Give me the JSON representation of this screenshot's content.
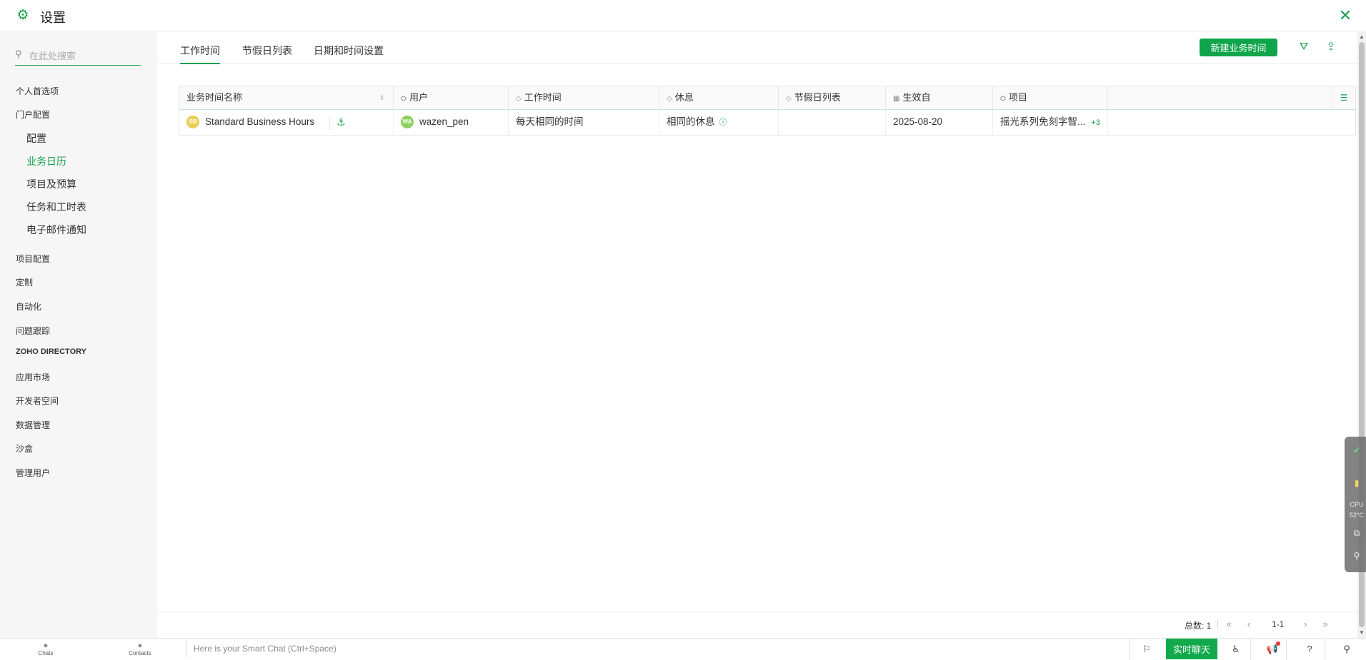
{
  "header": {
    "title": "设置"
  },
  "sidebar": {
    "search_placeholder": "在此处搜索",
    "items": [
      {
        "label": "个人首选项"
      },
      {
        "label": "门户配置"
      },
      {
        "label": "配置"
      },
      {
        "label": "业务日历"
      },
      {
        "label": "项目及预算"
      },
      {
        "label": "任务和工时表"
      },
      {
        "label": "电子邮件通知"
      },
      {
        "label": "项目配置"
      },
      {
        "label": "定制"
      },
      {
        "label": "自动化"
      },
      {
        "label": "问题跟踪"
      },
      {
        "label": "ZOHO DIRECTORY"
      },
      {
        "label": "应用市场"
      },
      {
        "label": "开发者空间"
      },
      {
        "label": "数据管理"
      },
      {
        "label": "沙盒"
      },
      {
        "label": "管理用户"
      }
    ]
  },
  "tabs": [
    {
      "label": "工作时间"
    },
    {
      "label": "节假日列表"
    },
    {
      "label": "日期和时间设置"
    }
  ],
  "toolbar": {
    "new_button": "新建业务时间"
  },
  "table": {
    "columns": [
      "业务时间名称",
      "用户",
      "工作时间",
      "休息",
      "节假日列表",
      "生效自",
      "项目"
    ],
    "rows": [
      {
        "name_avatar": "SB",
        "name": "Standard Business Hours",
        "user_avatar": "WA",
        "user": "wazen_pen",
        "work_time": "每天相同的时间",
        "break": "相同的休息",
        "holiday": "",
        "effective": "2025-08-20",
        "project": "摇光系列免刻字智...",
        "project_more": "+3"
      }
    ]
  },
  "pager": {
    "total": "总数: 1",
    "range": "1-1"
  },
  "widget": {
    "cpu_label": "CPU",
    "cpu_temp": "52°C"
  },
  "footer": {
    "chats": "Chats",
    "contacts": "Contacts",
    "chat_placeholder": "Here is your Smart Chat (Ctrl+Space)",
    "live_chat": "实时聊天"
  },
  "colors": {
    "accent": "#1aa14e",
    "button": "#0fa54a",
    "sidebar_bg": "#f6f6f6",
    "avatar_sb": "#e8cf55",
    "avatar_wa": "#8bd15f"
  }
}
